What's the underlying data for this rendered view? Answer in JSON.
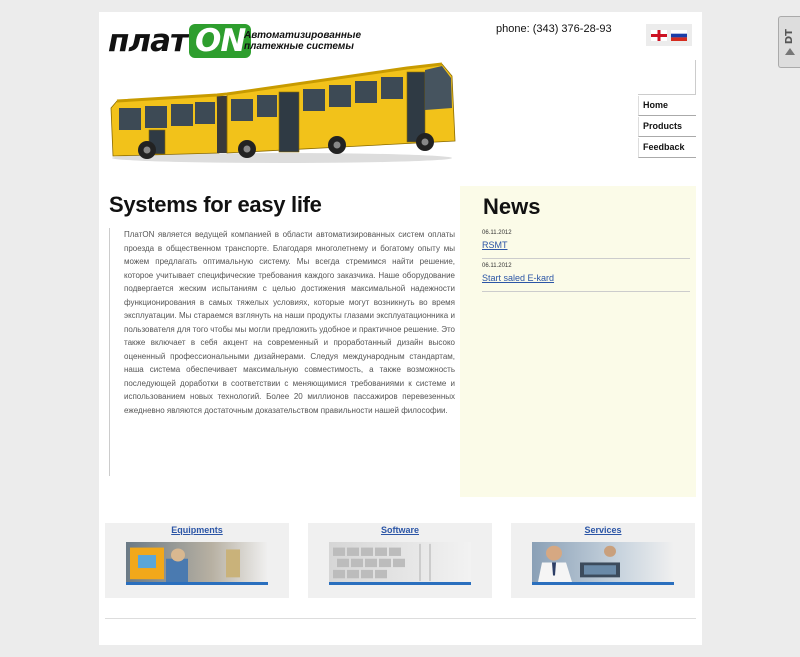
{
  "header": {
    "logo_text": "плат",
    "logo_highlight": "ON",
    "tagline_line1": "Автоматизированные",
    "tagline_line2": "платежные системы",
    "phone": "phone: (343) 376-28-93"
  },
  "languages": [
    "english-flag-icon",
    "russian-flag-icon"
  ],
  "nav": {
    "home": "Home",
    "products": "Products",
    "feedback": "Feedback"
  },
  "main": {
    "title": "Systems for easy life",
    "about": "ПлатON является ведущей компанией в области автоматизированных систем оплаты проезда в общественном транспорте. Благодаря многолетнему и богатому опыту мы можем предлагать оптимальную систему. Мы всегда стремимся найти решение, которое учитывает специфические требования каждого заказчика. Наше оборудование подвергается жеским испытаниям с целью достижения максимальной надежности функционирования в самых тяжелых условиях, которые могут возникнуть во время эксплуатации. Мы стараемся взглянуть на наши продукты глазами эксплуатационника и пользователя для того чтобы мы могли предложить удобное и практичное решение. Это также включает в себя акцент на современный и проработанный дизайн высоко оцененный профессиональными дизайнерами. Следуя международным стандартам, наша система обеспечивает максимальную совместимость, а также возможность последующей доработки в соответствии с меняющимися требованиями к системе и использованием новых технологий. Более 20 миллионов пассажиров перевезенных ежедневно являются достаточным доказательством правильности нашей философии."
  },
  "news": {
    "title": "News",
    "items": [
      {
        "date": "06.11.2012",
        "link": "RSMT"
      },
      {
        "date": "06.11.2012",
        "link": "Start saled E-kard"
      }
    ]
  },
  "boxes": [
    {
      "title": "Equipments"
    },
    {
      "title": "Software"
    },
    {
      "title": "Services"
    }
  ],
  "side_tab": {
    "label": "DT"
  },
  "colors": {
    "logo_green": "#2e9e2e",
    "link_blue": "#2b55a6",
    "news_bg": "#fbfbe8",
    "bus_yellow": "#f2c21a"
  }
}
